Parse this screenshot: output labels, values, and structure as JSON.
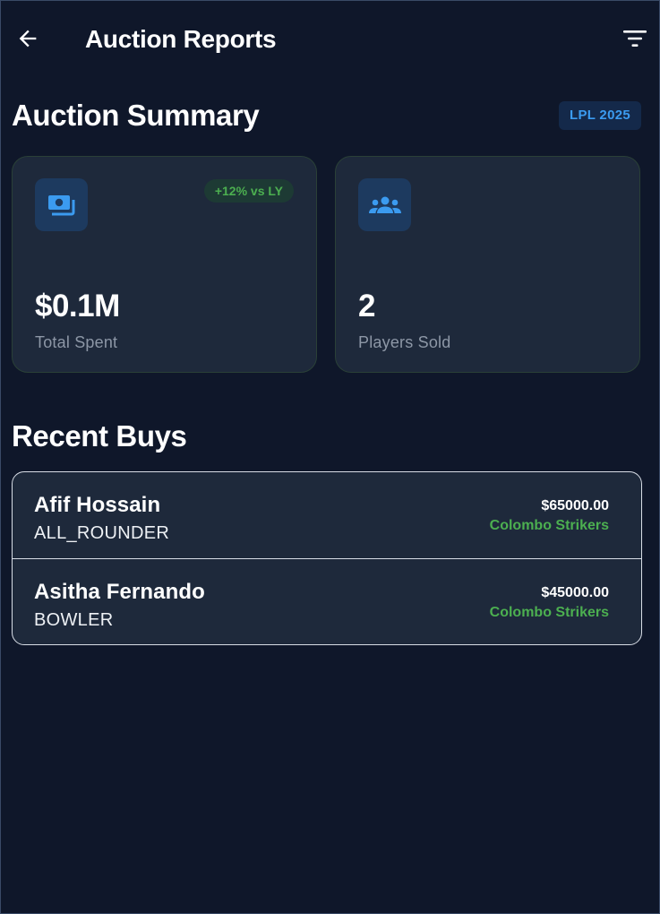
{
  "header": {
    "title": "Auction Reports",
    "back_icon": "arrow-left-icon",
    "filter_icon": "filter-icon"
  },
  "summary": {
    "heading": "Auction Summary",
    "season_badge": "LPL 2025",
    "cards": [
      {
        "icon": "money-icon",
        "trend": "+12% vs LY",
        "value": "$0.1M",
        "label": "Total Spent"
      },
      {
        "icon": "group-icon",
        "value": "2",
        "label": "Players Sold"
      }
    ]
  },
  "recent": {
    "heading": "Recent Buys",
    "items": [
      {
        "name": "Afif Hossain",
        "role": "ALL_ROUNDER",
        "price": "$65000.00",
        "team": "Colombo Strikers"
      },
      {
        "name": "Asitha Fernando",
        "role": "BOWLER",
        "price": "$45000.00",
        "team": "Colombo Strikers"
      }
    ]
  },
  "colors": {
    "background": "#0f172a",
    "card": "#1e293b",
    "accent_blue": "#3b9bf0",
    "accent_green": "#4caf50",
    "muted_text": "#8d97a6"
  }
}
